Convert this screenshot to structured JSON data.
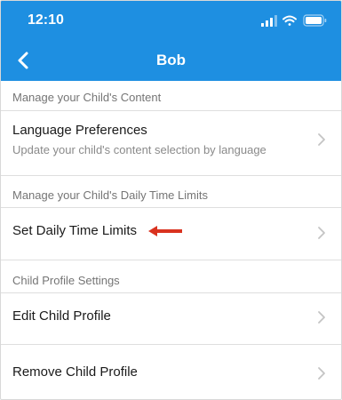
{
  "status_bar": {
    "time": "12:10",
    "icons": [
      "cellular-signal-icon",
      "wifi-icon",
      "battery-icon"
    ]
  },
  "nav": {
    "title": "Bob",
    "back_icon": "chevron-left-icon"
  },
  "sections": [
    {
      "header": "Manage your Child's Content",
      "rows": [
        {
          "title": "Language Preferences",
          "subtitle": "Update your child's content selection by language"
        }
      ]
    },
    {
      "header": "Manage your Child's Daily Time Limits",
      "rows": [
        {
          "title": "Set Daily Time Limits"
        }
      ]
    },
    {
      "header": "Child Profile Settings",
      "rows": [
        {
          "title": "Edit Child Profile"
        },
        {
          "title": "Remove Child Profile"
        }
      ]
    }
  ],
  "colors": {
    "accent": "#1e8fe1",
    "annotation_arrow": "#d9321f",
    "divider": "#dedede"
  }
}
